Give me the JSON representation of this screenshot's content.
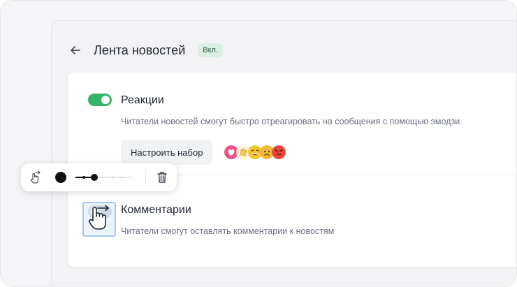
{
  "header": {
    "title": "Лента новостей",
    "badge": "Вкл."
  },
  "reactions": {
    "title": "Реакции",
    "description": "Читатели новостей смогут быстро отреагировать на сообщения с помощью эмодзи.",
    "enabled": true,
    "setup_button": "Настроить набор",
    "emojis": [
      "heart",
      "clap",
      "laugh",
      "sad",
      "angry"
    ]
  },
  "comments": {
    "title": "Комментарии",
    "description": "Читатели смогут оставлять комментарии к новостям",
    "enabled": false
  },
  "toolbar": {
    "tools": [
      "hand-swipe-icon",
      "color-dot",
      "stroke-slider",
      "trash-icon"
    ]
  },
  "colors": {
    "accent_green": "#34b36b",
    "badge_bg": "#dbeee3",
    "text_dark": "#1f2430",
    "text_muted": "#6b7080"
  }
}
